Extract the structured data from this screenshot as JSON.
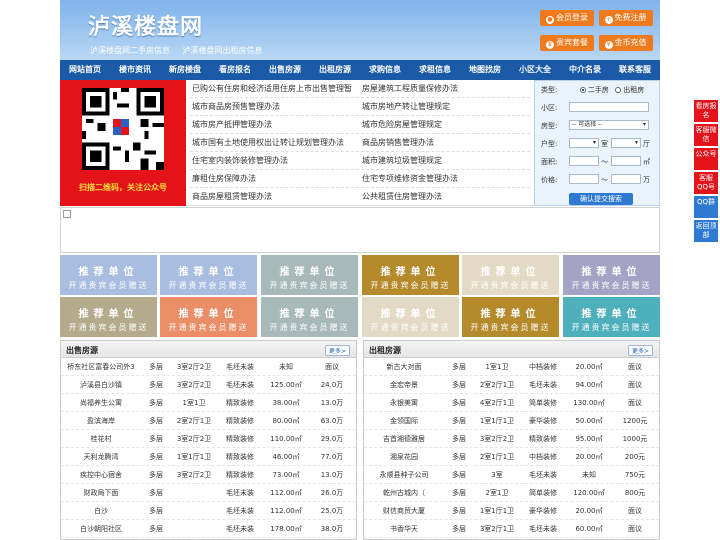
{
  "header": {
    "logo": "泸溪楼盘网",
    "subtitle": [
      "泸溪楼盘网二手房信息",
      "泸溪楼盘网出租房信息"
    ],
    "buttons": [
      "会员登录",
      "免费注册",
      "贵宾套餐",
      "金币充值"
    ],
    "brand_color": "#1a5aa6",
    "accent_color": "#ee7a1d"
  },
  "nav": [
    "网站首页",
    "楼市资讯",
    "新房楼盘",
    "看房报名",
    "出售房源",
    "出租房源",
    "求购信息",
    "求租信息",
    "地图找房",
    "小区大全",
    "中介名录",
    "联系客服"
  ],
  "qr": {
    "caption": "扫描二维码，关注公众号"
  },
  "news": [
    [
      "已购公有住房和经济适用住房上市出售管理暂",
      "房屋建筑工程质量保修办法"
    ],
    [
      "城市商品房预售管理办法",
      "城市房地产转让管理规定"
    ],
    [
      "城市房产抵押管理办法",
      "城市危险房屋管理规定"
    ],
    [
      "城市国有土地使用权出让转让规划管理办法",
      "商品房销售管理办法"
    ],
    [
      "住宅室内装饰装修管理办法",
      "城市建筑垃圾管理规定"
    ],
    [
      "廉租住房保障办法",
      "住宅专项维修资金管理办法"
    ],
    [
      "商品房屋租赁管理办法",
      "公共租赁住房管理办法"
    ]
  ],
  "search": {
    "type_label": "类型:",
    "type_options": [
      "二手房",
      "出租房"
    ],
    "community_label": "小区:",
    "house_type_label": "房型:",
    "house_type_value": "-- 可选择 --",
    "layout_label": "户型:",
    "layout_units": [
      "室",
      "厅"
    ],
    "area_label": "面积:",
    "area_unit": "㎡",
    "price_label": "价格:",
    "price_unit": "万",
    "range_sep": "〜",
    "submit": "确认提交搜索"
  },
  "tiles": {
    "title": "推荐单位",
    "sub": "开通贵宾会员赠送",
    "colors": [
      "#a9bde0",
      "#a9bde0",
      "#a7b9b9",
      "#b58a2a",
      "#e3dac6",
      "#a5a3c5",
      "#b3ab8c",
      "#e98e67",
      "#a7b9b9",
      "#e3dac6",
      "#b58a2a",
      "#4fb0bd"
    ]
  },
  "sale": {
    "title": "出售房源",
    "more": "更多>",
    "rows": [
      [
        "桥东社区富春公司外3",
        "多层",
        "3室2厅2卫",
        "毛坯未装",
        "未知",
        "面议"
      ],
      [
        "泸溪县白沙镇",
        "多层",
        "3室2厅2卫",
        "毛坯未装",
        "125.00㎡",
        "24.0万"
      ],
      [
        "尚福养生公寓",
        "多层",
        "1室1卫",
        "精致装修",
        "38.00㎡",
        "13.0万"
      ],
      [
        "盈滨海岸",
        "多层",
        "2室2厅1卫",
        "精致装修",
        "80.00㎡",
        "63.0万"
      ],
      [
        "桂花村",
        "多层",
        "3室2厅2卫",
        "精致装修",
        "110.00㎡",
        "29.0万"
      ],
      [
        "天利龙腾湾",
        "多层",
        "1室1厅1卫",
        "精致装修",
        "46.00㎡",
        "77.0万"
      ],
      [
        "疾控中心宿舍",
        "多层",
        "3室2厅2卫",
        "精致装修",
        "73.00㎡",
        "13.0万"
      ],
      [
        "财政局下面",
        "多层",
        "",
        "毛坯未装",
        "112.00㎡",
        "26.0万"
      ],
      [
        "白沙",
        "多层",
        "",
        "毛坯未装",
        "112.00㎡",
        "25.0万"
      ],
      [
        "白沙朝阳社区",
        "多层",
        "",
        "毛坯未装",
        "178.00㎡",
        "38.0万"
      ]
    ]
  },
  "rent": {
    "title": "出租房源",
    "more": "更多>",
    "rows": [
      [
        "新古大对面",
        "多层",
        "1室1卫",
        "中档装修",
        "20.00㎡",
        "面议"
      ],
      [
        "金宏帝景",
        "多层",
        "2室2厅1卫",
        "毛坯未装",
        "94.00㎡",
        "面议"
      ],
      [
        "永银美寓",
        "多层",
        "4室2厅1卫",
        "简单装修",
        "130.00㎡",
        "面议"
      ],
      [
        "金领国际",
        "多层",
        "1室1厅1卫",
        "豪华装修",
        "50.00㎡",
        "1200元"
      ],
      [
        "吉首湘德雅居",
        "多层",
        "3室2厅2卫",
        "精致装修",
        "95.00㎡",
        "1000元"
      ],
      [
        "湘泉花园",
        "多层",
        "2室1厅1卫",
        "中档装修",
        "20.00㎡",
        "200元"
      ],
      [
        "永顺县种子公司",
        "多层",
        "3室",
        "毛坯未装",
        "未知",
        "750元"
      ],
      [
        "乾州古城内（",
        "多层",
        "2室1卫",
        "简单装修",
        "120.00㎡",
        "800元"
      ],
      [
        "财信商贸大厦",
        "多层",
        "1室1厅1卫",
        "豪华装修",
        "20.00㎡",
        "面议"
      ],
      [
        "书香华天",
        "多层",
        "3室2厅1卫",
        "毛坯未装",
        "60.00㎡",
        "面议"
      ]
    ]
  },
  "side": [
    "看房报名",
    "客服微信",
    "公众号",
    "客服QQ号",
    "QQ群",
    "返回顶部"
  ]
}
